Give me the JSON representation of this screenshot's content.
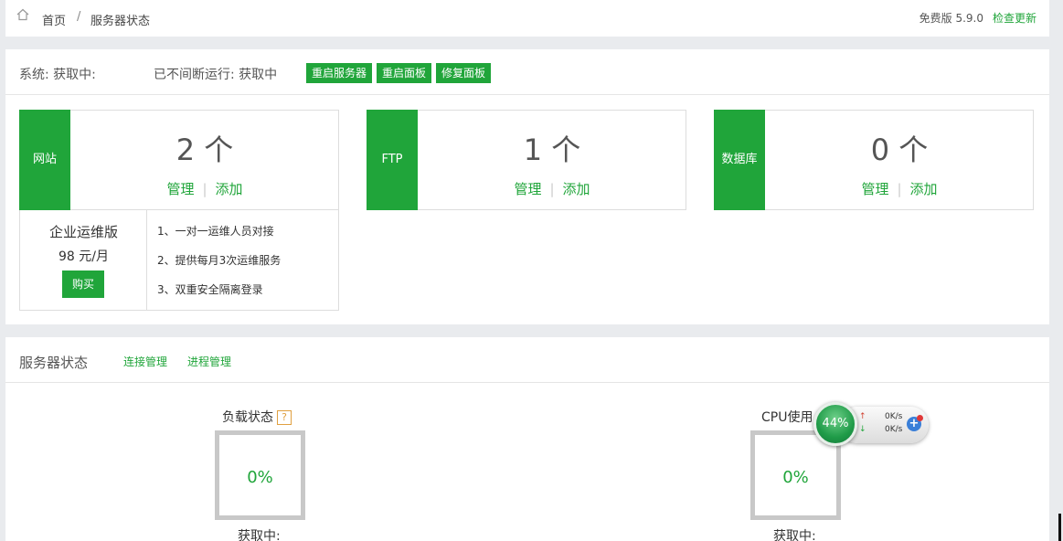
{
  "topbar": {
    "breadcrumb_home": "首页",
    "breadcrumb_sep": "/",
    "breadcrumb_current": "服务器状态",
    "version": "免费版 5.9.0",
    "check_update": "检查更新"
  },
  "system": {
    "system_label": "系统: 获取中:",
    "uptime_label": "已不间断运行: 获取中",
    "buttons": [
      "重启服务器",
      "重启面板",
      "修复面板"
    ]
  },
  "cards": [
    {
      "tag": "网站",
      "count": "2 个",
      "manage": "管理",
      "add": "添加"
    },
    {
      "tag": "FTP",
      "count": "1 个",
      "manage": "管理",
      "add": "添加"
    },
    {
      "tag": "数据库",
      "count": "0 个",
      "manage": "管理",
      "add": "添加"
    }
  ],
  "enterprise": {
    "title": "企业运维版",
    "price": "98 元/月",
    "buy_label": "购买",
    "features": [
      "1、一对一运维人员对接",
      "2、提供每月3次运维服务",
      "3、双重安全隔离登录"
    ]
  },
  "server_status": {
    "title": "服务器状态",
    "links": [
      "连接管理",
      "进程管理"
    ],
    "load": {
      "label": "负载状态",
      "help": "?",
      "value": "0%",
      "status": "获取中:"
    },
    "cpu": {
      "label": "CPU使用",
      "value": "0%",
      "status": "获取中:"
    }
  },
  "float_widget": {
    "percent": "44%",
    "up_arrow": "↑",
    "down_arrow": "↓",
    "up_speed": "0K/s",
    "down_speed": "0K/s",
    "plus": "+"
  },
  "colors": {
    "accent": "#20a53a",
    "background": "#e9ebee"
  }
}
